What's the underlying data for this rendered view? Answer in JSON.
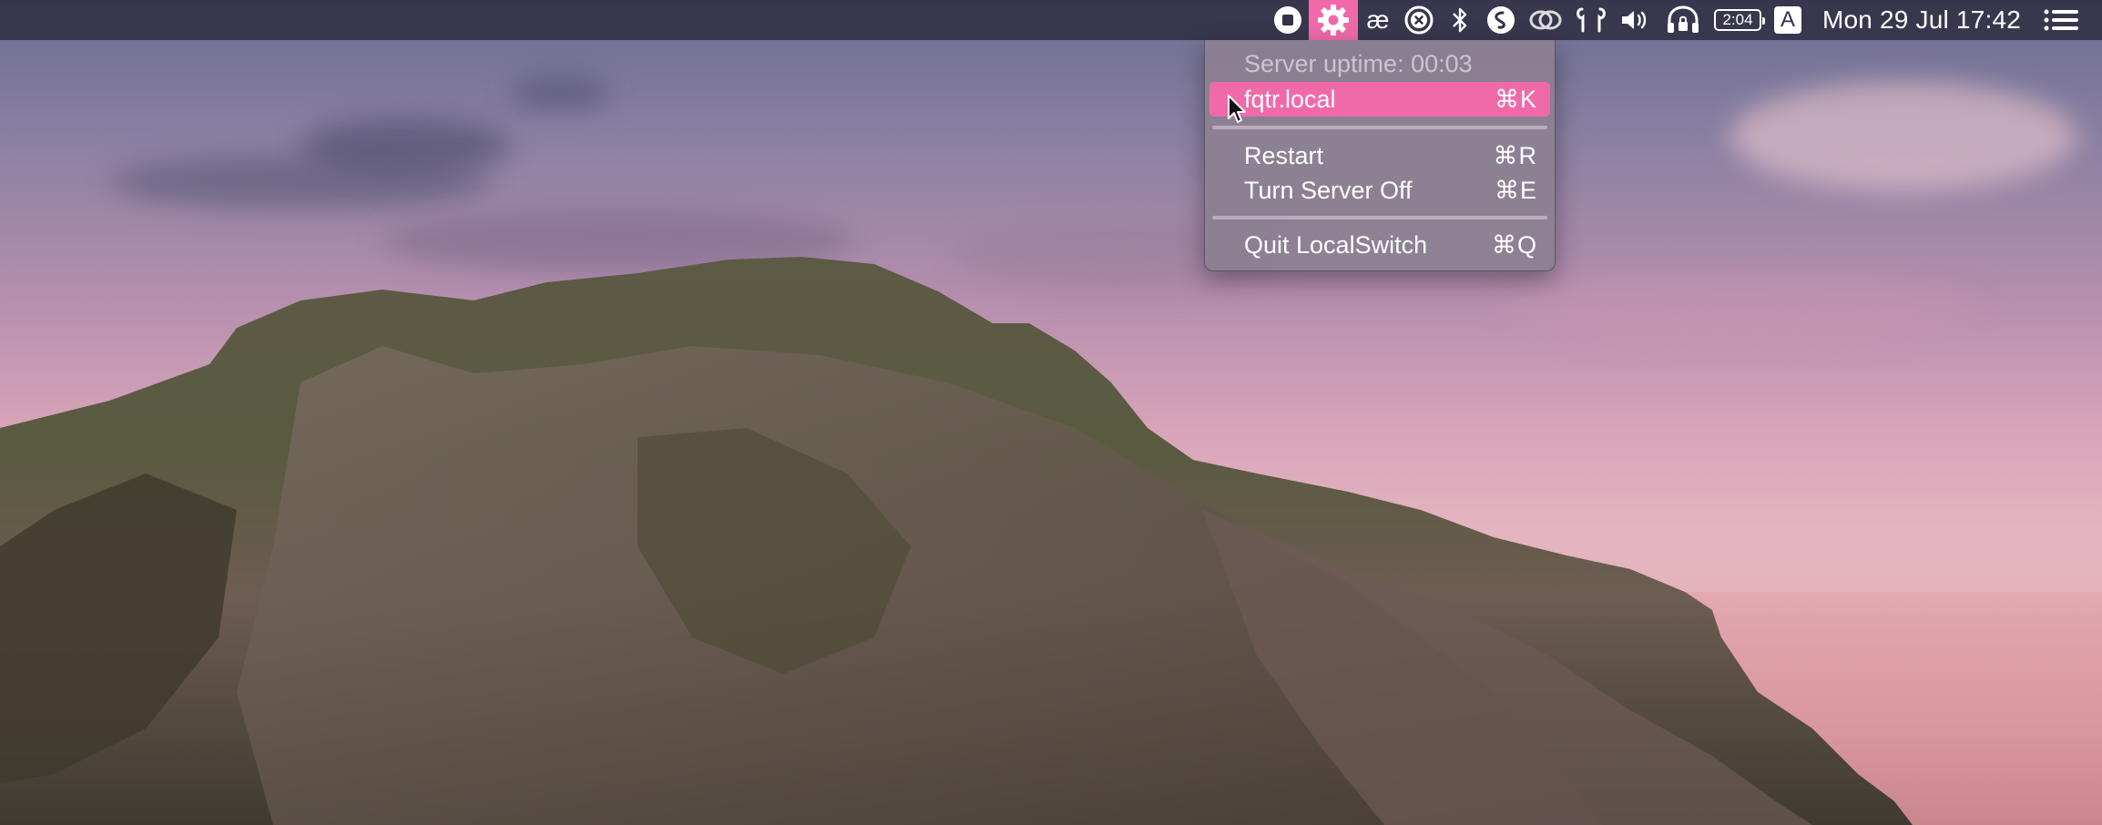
{
  "menubar": {
    "clock": "Mon 29 Jul  17:42",
    "battery_label": "2:04",
    "input_source": "A",
    "ae_label": "æ"
  },
  "menu": {
    "uptime": "Server uptime: 00:03",
    "items": [
      {
        "label": "fqtr.local",
        "shortcut": "⌘K"
      },
      {
        "label": "Restart",
        "shortcut": "⌘R"
      },
      {
        "label": "Turn Server Off",
        "shortcut": "⌘E"
      },
      {
        "label": "Quit LocalSwitch",
        "shortcut": "⌘Q"
      }
    ]
  },
  "colors": {
    "accent": "#f06aa9",
    "menubar": "#343248",
    "menu_bg": "#8c8091"
  }
}
